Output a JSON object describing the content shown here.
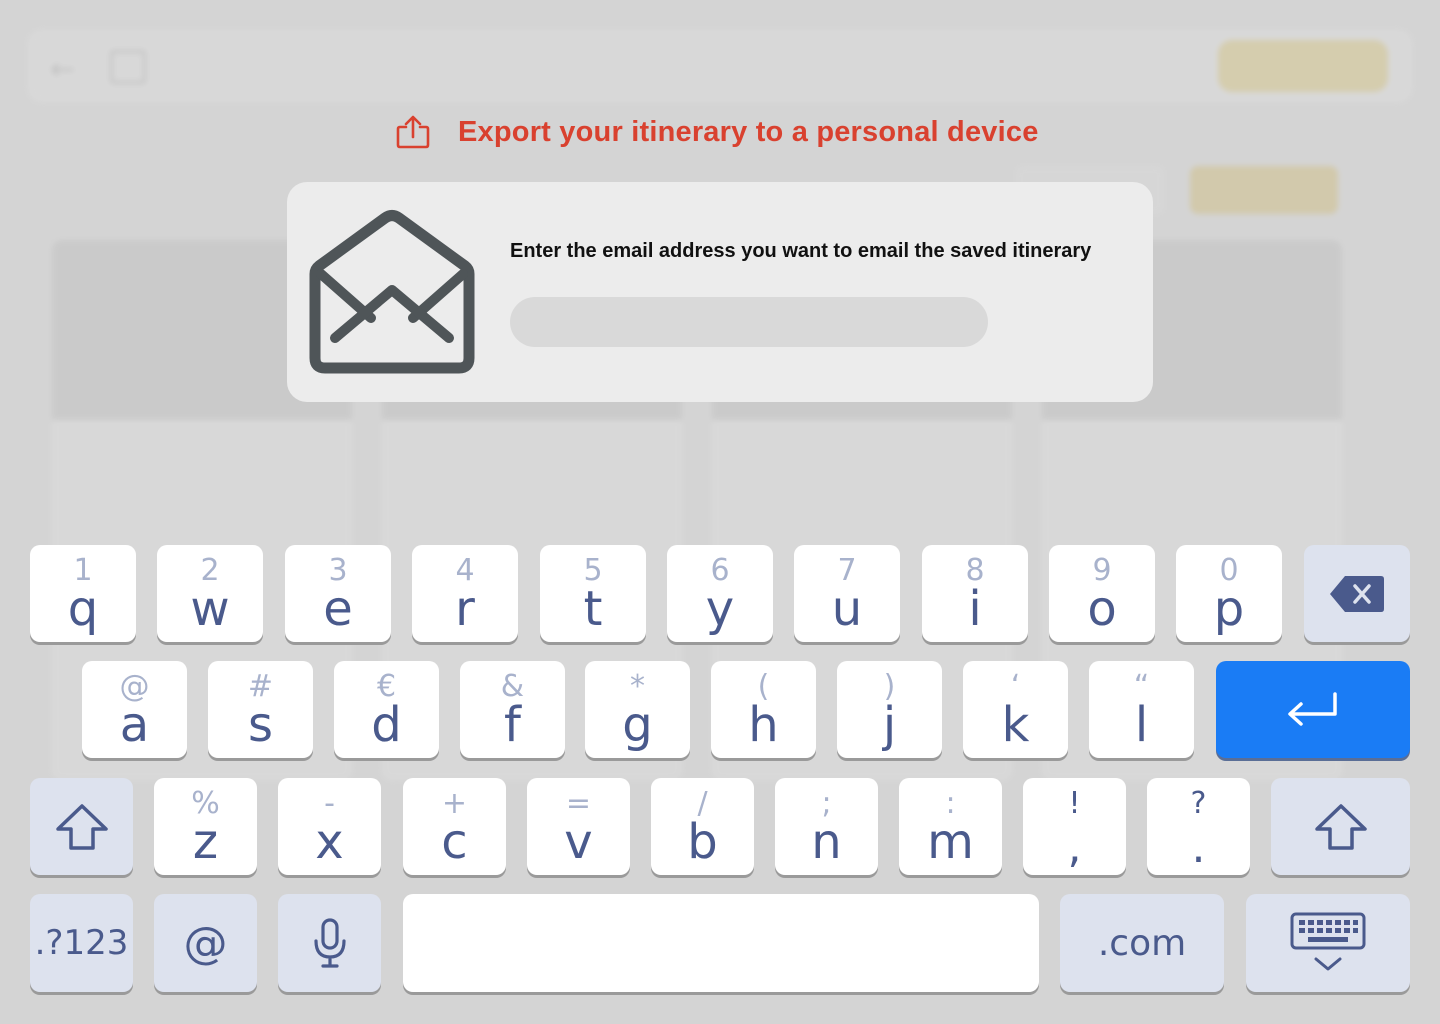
{
  "export": {
    "title": "Export your itinerary to a personal device",
    "icon": "share-export-icon",
    "color": "#d9412f"
  },
  "dialog": {
    "icon": "envelope-open-icon",
    "prompt": "Enter the email address you want to email the saved itinerary",
    "email_value": "",
    "email_placeholder": ""
  },
  "keyboard": {
    "row1": [
      {
        "sec": "1",
        "pri": "q"
      },
      {
        "sec": "2",
        "pri": "w"
      },
      {
        "sec": "3",
        "pri": "e"
      },
      {
        "sec": "4",
        "pri": "r"
      },
      {
        "sec": "5",
        "pri": "t"
      },
      {
        "sec": "6",
        "pri": "y"
      },
      {
        "sec": "7",
        "pri": "u"
      },
      {
        "sec": "8",
        "pri": "i"
      },
      {
        "sec": "9",
        "pri": "o"
      },
      {
        "sec": "0",
        "pri": "p"
      }
    ],
    "row2": [
      {
        "sec": "@",
        "pri": "a"
      },
      {
        "sec": "#",
        "pri": "s"
      },
      {
        "sec": "€",
        "pri": "d"
      },
      {
        "sec": "&",
        "pri": "f"
      },
      {
        "sec": "*",
        "pri": "g"
      },
      {
        "sec": "(",
        "pri": "h"
      },
      {
        "sec": ")",
        "pri": "j"
      },
      {
        "sec": "‘",
        "pri": "k"
      },
      {
        "sec": "“",
        "pri": "l"
      }
    ],
    "row3": [
      {
        "sec": "%",
        "pri": "z"
      },
      {
        "sec": "-",
        "pri": "x"
      },
      {
        "sec": "+",
        "pri": "c"
      },
      {
        "sec": "=",
        "pri": "v"
      },
      {
        "sec": "/",
        "pri": "b"
      },
      {
        "sec": ";",
        "pri": "n"
      },
      {
        "sec": ":",
        "pri": "m"
      },
      {
        "sec": "!",
        "pri": ","
      },
      {
        "sec": "?",
        "pri": "."
      }
    ],
    "symbols_label": ".?123",
    "at_label": "@",
    "dotcom_label": ".com",
    "icons": {
      "backspace": "backspace-icon",
      "enter": "enter-icon",
      "shift": "shift-icon",
      "mic": "microphone-icon",
      "hide": "hide-keyboard-icon"
    },
    "accent_color": "#1a7cf5"
  }
}
